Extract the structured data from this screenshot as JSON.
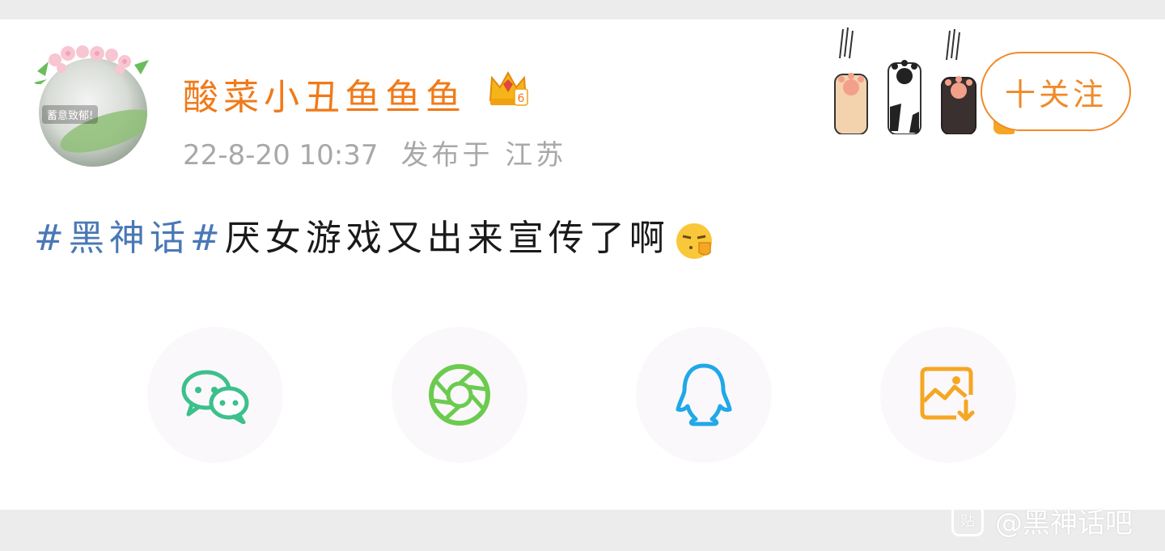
{
  "user": {
    "name": "酸菜小丑鱼鱼鱼",
    "avatar_tag": "蓄意致郁!",
    "level_badge": "6",
    "timestamp": "22-8-20 10:37",
    "location": "发布于 江苏"
  },
  "follow_button": {
    "label": "十关注"
  },
  "post": {
    "topic": "#黑神话#",
    "text": "厌女游戏又出来宣传了啊"
  },
  "share": [
    {
      "name": "wechat",
      "icon": "wechat-icon",
      "color": "#3cc08c"
    },
    {
      "name": "moments",
      "icon": "moments-icon",
      "color": "#6bcb4f"
    },
    {
      "name": "qq",
      "icon": "qq-icon",
      "color": "#20a8e8"
    },
    {
      "name": "save-image",
      "icon": "save-image-icon",
      "color": "#f5a623"
    }
  ],
  "watermark": {
    "logo": "贴",
    "text": "@黑神话吧"
  },
  "colors": {
    "accent": "#f07a19",
    "topic": "#4a78b6",
    "meta": "#a8a8a8",
    "background": "#ececec"
  }
}
